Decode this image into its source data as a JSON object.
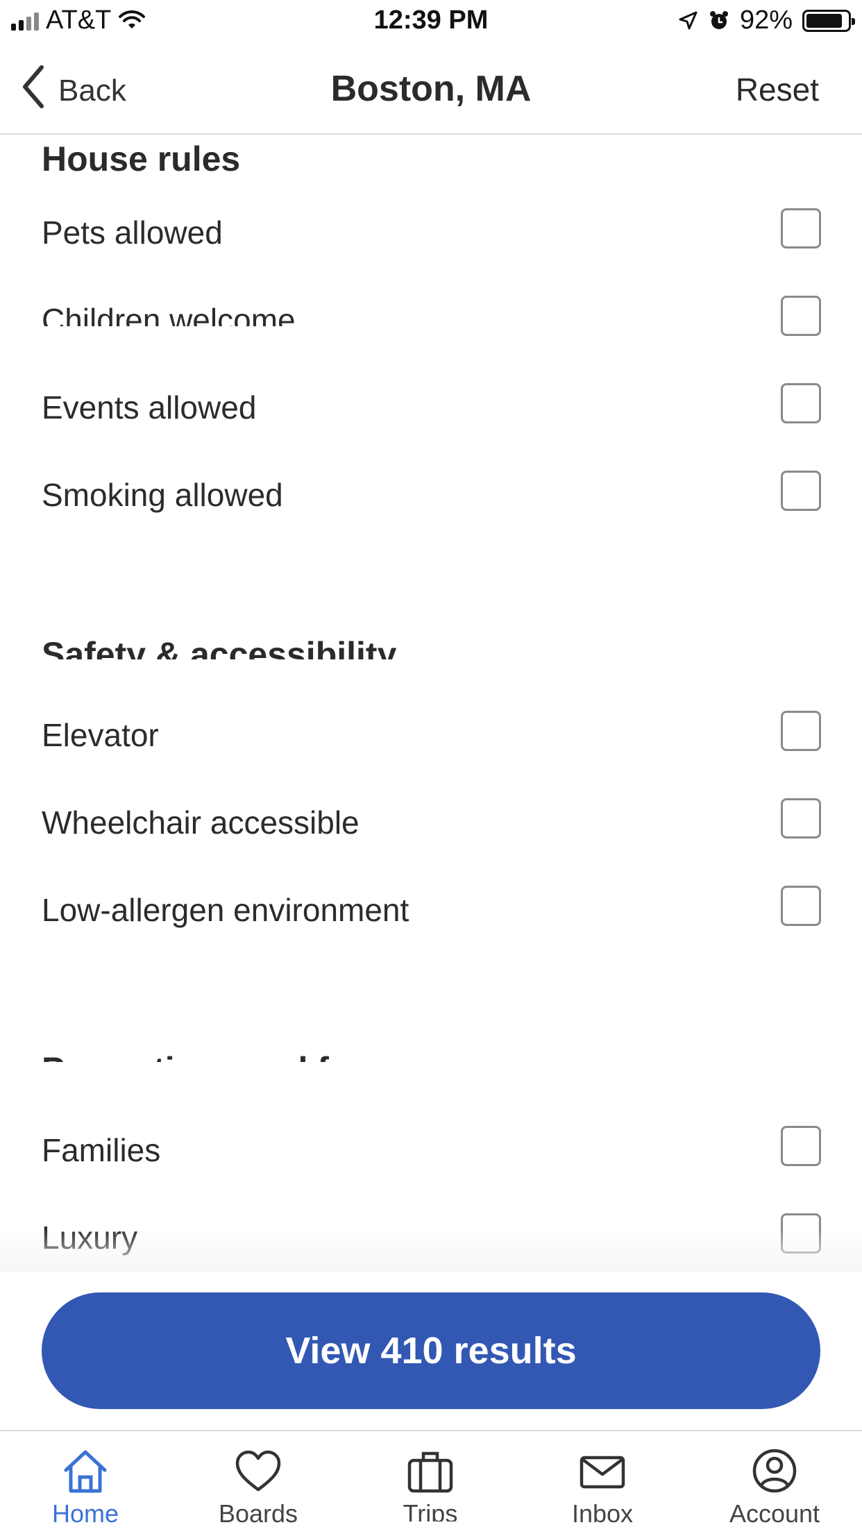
{
  "status_bar": {
    "carrier": "AT&T",
    "time": "12:39 PM",
    "battery": "92%",
    "battery_level": 0.92
  },
  "header": {
    "back_label": "Back",
    "title": "Boston,  MA",
    "reset_label": "Reset"
  },
  "sections": [
    {
      "title": "House rules",
      "items": [
        {
          "label": "Pets allowed",
          "checked": false
        },
        {
          "label": "Children welcome",
          "checked": false
        },
        {
          "label": "Events allowed",
          "checked": false
        },
        {
          "label": "Smoking allowed",
          "checked": false
        }
      ]
    },
    {
      "title": "Safety & accessibility",
      "items": [
        {
          "label": "Elevator",
          "checked": false
        },
        {
          "label": "Wheelchair accessible",
          "checked": false
        },
        {
          "label": "Low-allergen environment",
          "checked": false
        }
      ]
    },
    {
      "title": "Properties good for",
      "items": [
        {
          "label": "Families",
          "checked": false
        },
        {
          "label": "Luxury",
          "checked": false
        }
      ]
    }
  ],
  "cta": {
    "label": "View 410 results"
  },
  "tabbar": {
    "items": [
      {
        "label": "Home",
        "icon": "home-icon",
        "active": true
      },
      {
        "label": "Boards",
        "icon": "heart-icon",
        "active": false
      },
      {
        "label": "Trips",
        "icon": "suitcase-icon",
        "active": false
      },
      {
        "label": "Inbox",
        "icon": "envelope-icon",
        "active": false
      },
      {
        "label": "Account",
        "icon": "account-icon",
        "active": false
      }
    ]
  },
  "colors": {
    "accent": "#3258b3",
    "active_tab": "#3a72d6",
    "text": "#2b2b2b",
    "checkbox_border": "#8a8a8a"
  }
}
